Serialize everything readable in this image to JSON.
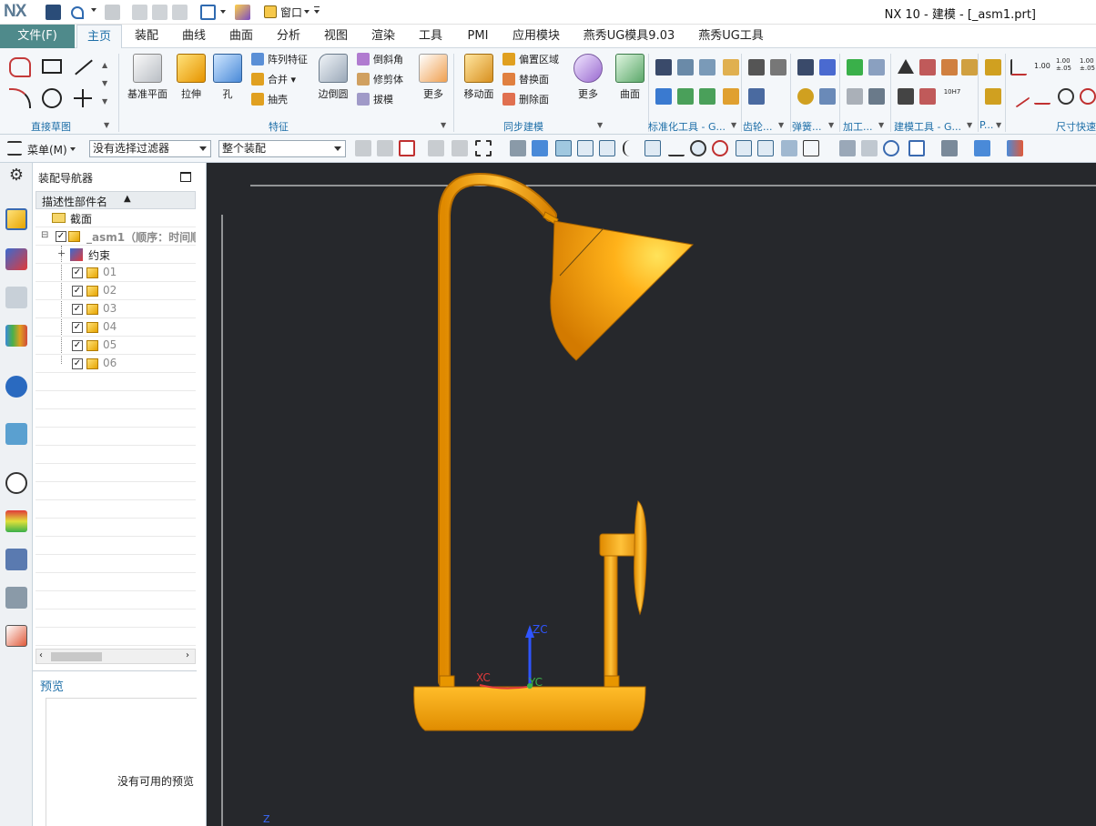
{
  "app": {
    "logo": "NX",
    "window_title": "NX 10 - 建模 - [_asm1.prt]"
  },
  "quick_access": {
    "window_menu": "窗口"
  },
  "menu": {
    "file": "文件(F)",
    "tabs": [
      "主页",
      "装配",
      "曲线",
      "曲面",
      "分析",
      "视图",
      "渲染",
      "工具",
      "PMI",
      "应用模块",
      "燕秀UG模具9.03",
      "燕秀UG工具"
    ],
    "active_tab": 0
  },
  "ribbon": {
    "groups": {
      "sketch": "直接草图",
      "feature": "特征",
      "sync": "同步建模",
      "std": "标准化工具 - G...",
      "gear": "齿轮...",
      "spring": "弹簧...",
      "machining": "加工...",
      "modeling": "建模工具 - G...",
      "p": "P...",
      "dim": "尺寸快速"
    },
    "buttons": {
      "datum_plane": "基准平面",
      "extrude": "拉伸",
      "hole": "孔",
      "pattern": "阵列特征",
      "unite": "合并",
      "shell": "抽壳",
      "edge_blend": "边倒圆",
      "chamfer": "倒斜角",
      "trim_body": "修剪体",
      "draft": "拔模",
      "more1": "更多",
      "move_face": "移动面",
      "offset_region": "偏置区域",
      "replace_face": "替换面",
      "delete_face": "删除面",
      "more2": "更多",
      "surface": "曲面",
      "tol_1": "1.00",
      "tol_2": "1.00",
      "tol_3": "±.05",
      "tol_4": "1.00",
      "tol_5": "±.05",
      "fit": "10H7"
    }
  },
  "selbar": {
    "menu": "菜单(M)",
    "filter": "没有选择过滤器",
    "scope": "整个装配"
  },
  "navigator": {
    "title": "装配导航器",
    "column": "描述性部件名",
    "section_node": "截面",
    "asm_node": "_asm1（顺序：时间顺",
    "constraints": "约束",
    "parts": [
      "01",
      "02",
      "03",
      "04",
      "05",
      "06"
    ],
    "preview_title": "预览",
    "preview_empty": "没有可用的预览"
  },
  "viewport": {
    "axis_x": "XC",
    "axis_y": "YC",
    "axis_z": "ZC",
    "corner_z": "Z"
  },
  "colors": {
    "accent": "#1e6fa8",
    "file_tab": "#4f8a8b",
    "viewport_bg": "#26282c",
    "model": "#ffa800"
  }
}
